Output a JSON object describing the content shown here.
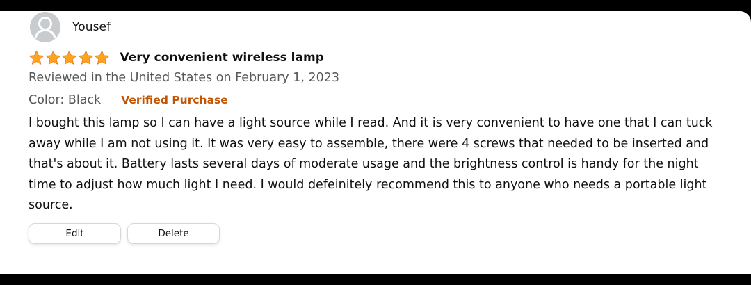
{
  "reviewer": {
    "name": "Yousef",
    "avatar_icon": "default-user-avatar-icon"
  },
  "review": {
    "rating": 5,
    "max_rating": 5,
    "star_color": "#ffa41c",
    "title": "Very convenient wireless lamp",
    "reviewed_in": "Reviewed in the United States on February 1, 2023",
    "variant": "Color: Black",
    "verified_label": "Verified Purchase",
    "verified_color": "#c45500",
    "body": "I bought this lamp so I can have a light source while I read. And it is very convenient to have one that I can tuck away while I am not using it. It was very easy to assemble, there were 4 screws that needed to be inserted and that's about it. Battery lasts several days of moderate usage and the brightness control is handy for the night time to adjust how much light I need. I would defeinitely recommend this to anyone who needs a portable light source."
  },
  "actions": {
    "edit_label": "Edit",
    "delete_label": "Delete"
  }
}
